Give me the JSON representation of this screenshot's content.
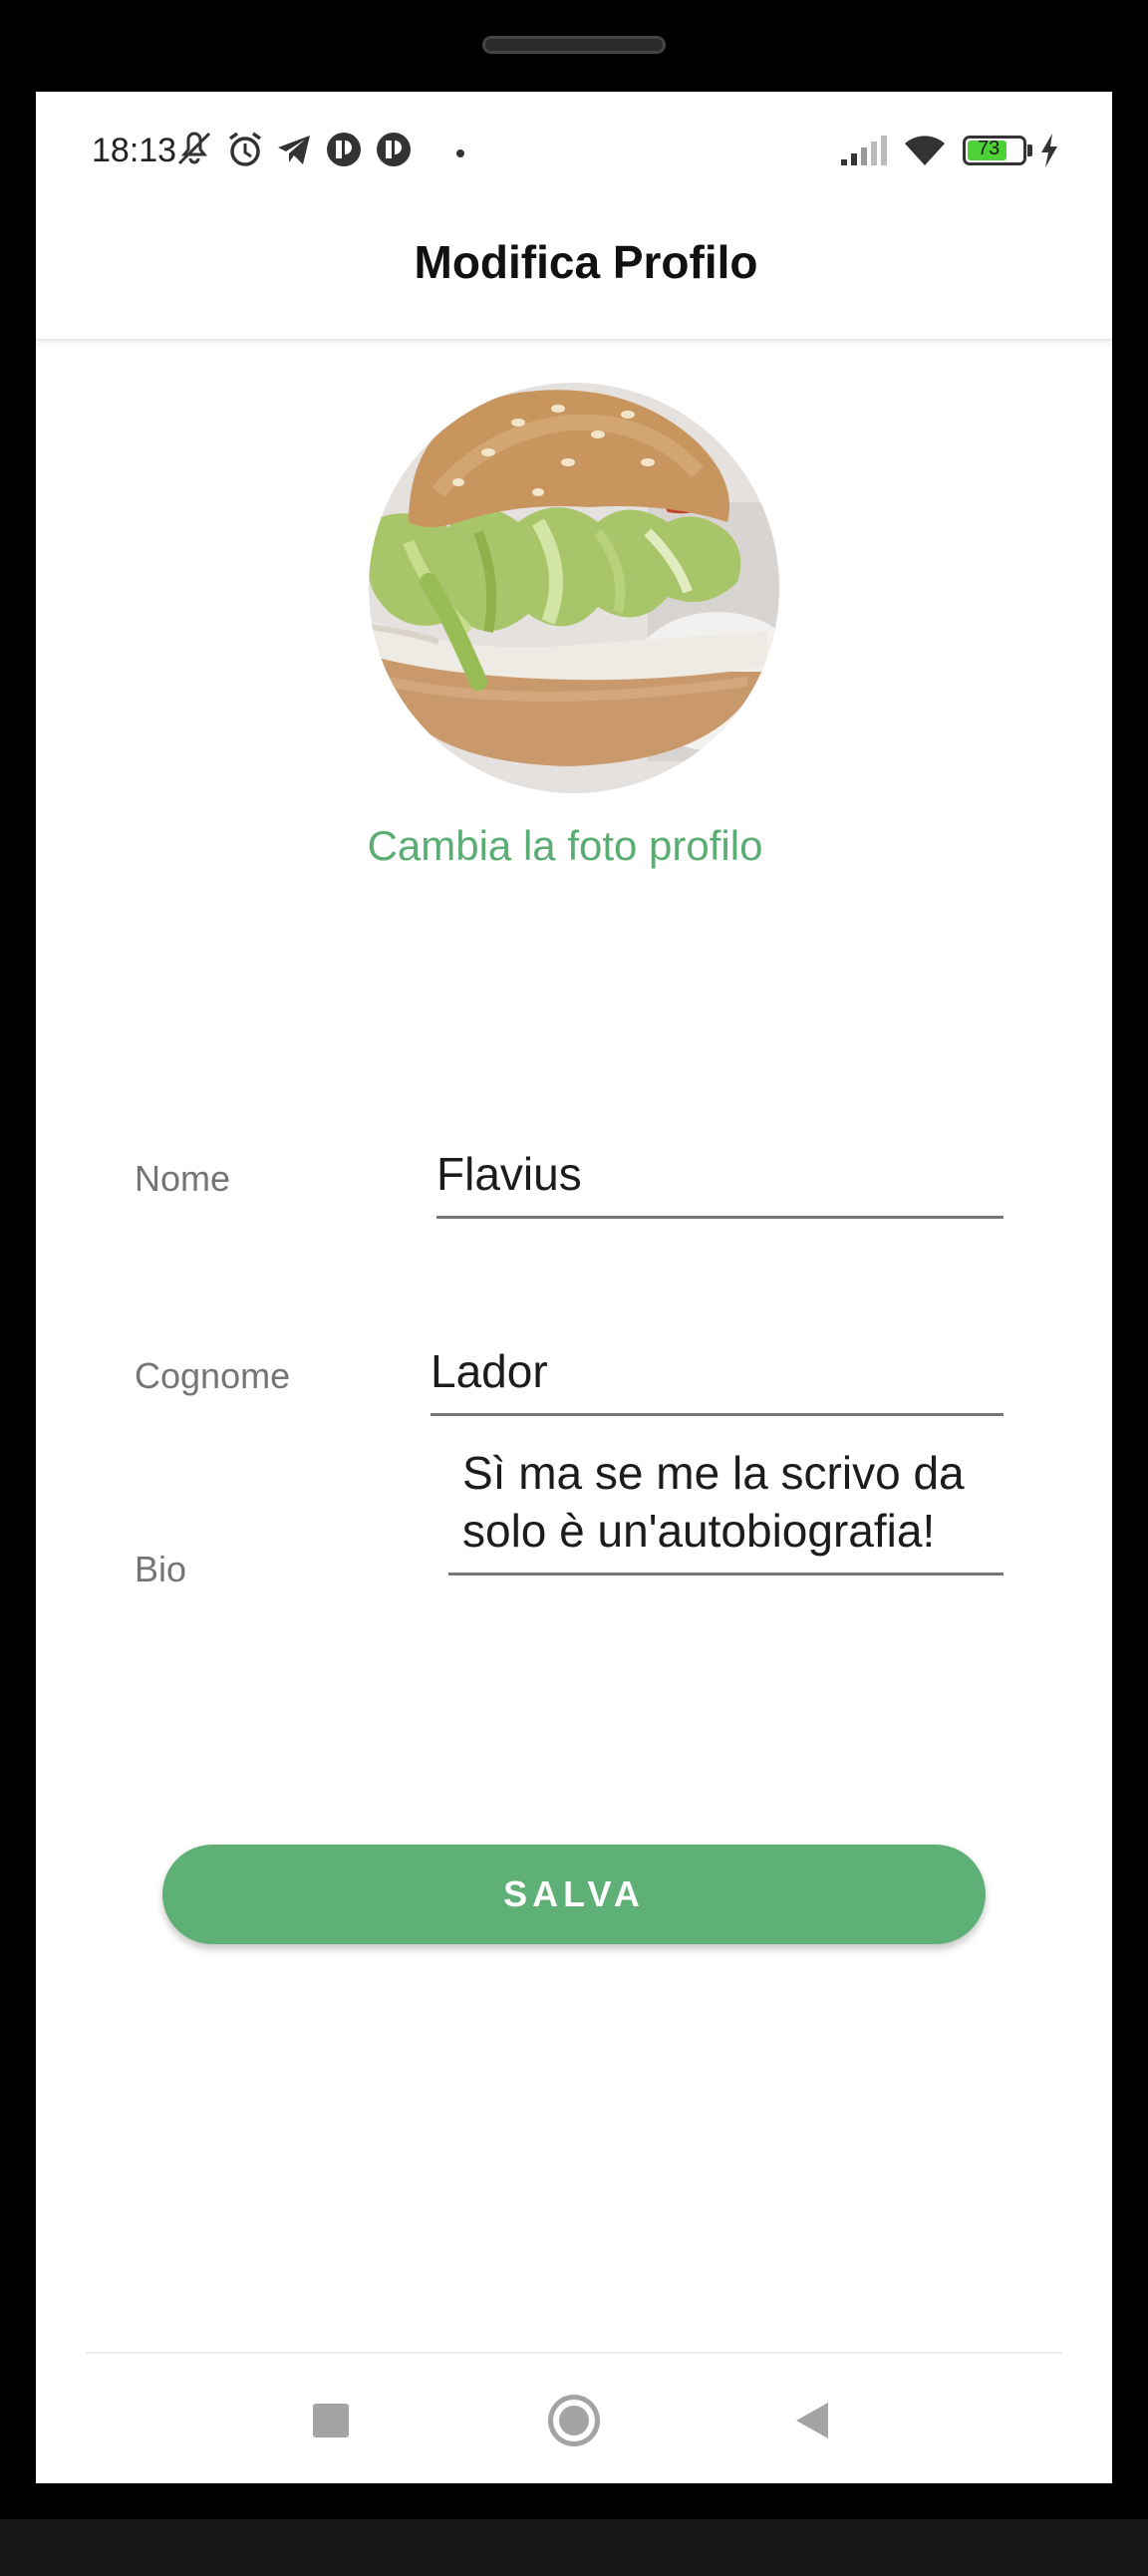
{
  "status_bar": {
    "time": "18:13",
    "battery_level": "73",
    "icons": [
      "vibrate-off-icon",
      "alarm-icon",
      "telegram-icon",
      "app-icon",
      "app-icon",
      "dot-icon",
      "signal-icon",
      "wifi-icon",
      "battery-icon",
      "charging-icon"
    ]
  },
  "app_bar": {
    "title": "Modifica Profilo"
  },
  "profile": {
    "avatar": "hamburger-photo",
    "change_photo_label": "Cambia la foto profilo"
  },
  "form": {
    "nome_label": "Nome",
    "nome_value": "Flavius",
    "cognome_label": "Cognome",
    "cognome_value": "Lador",
    "bio_label": "Bio",
    "bio_value": "Sì ma se me la scrivo da\nsolo è un'autobiografia!"
  },
  "actions": {
    "save_label": "SALVA"
  },
  "colors": {
    "accent": "#5fb077",
    "accent_text": "#5cad74"
  },
  "nav_bar": {
    "icons": [
      "recent-apps-icon",
      "home-icon",
      "back-icon"
    ]
  }
}
